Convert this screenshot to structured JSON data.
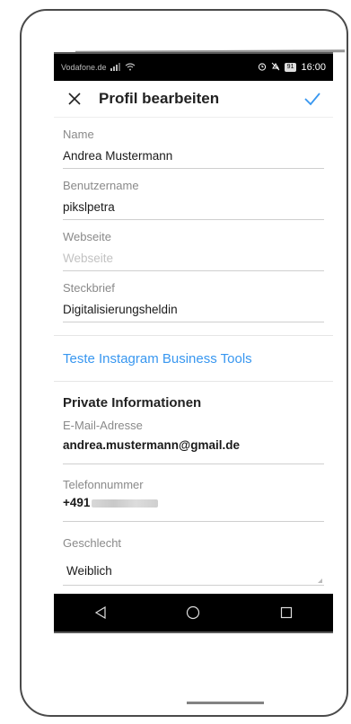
{
  "status_bar": {
    "carrier": "Vodafone.de",
    "battery": "91",
    "time": "16:00"
  },
  "app_bar": {
    "title": "Profil bearbeiten"
  },
  "fields": {
    "name": {
      "label": "Name",
      "value": "Andrea Mustermann"
    },
    "username": {
      "label": "Benutzername",
      "value": "pikslpetra"
    },
    "website": {
      "label": "Webseite",
      "placeholder": "Webseite"
    },
    "bio": {
      "label": "Steckbrief",
      "value": "Digitalisierungsheldin"
    }
  },
  "business_link": "Teste Instagram Business Tools",
  "private": {
    "title": "Private Informationen",
    "email": {
      "label": "E-Mail-Adresse",
      "value": "andrea.mustermann@gmail.de"
    },
    "phone": {
      "label": "Telefonnummer",
      "value": "+491"
    },
    "gender": {
      "label": "Geschlecht",
      "value": "Weiblich"
    }
  },
  "colors": {
    "accent": "#3897f0",
    "status_bar": "#000000"
  },
  "icons": {
    "close": "close-icon",
    "confirm": "checkmark-icon",
    "nav_back": "back-triangle-icon",
    "nav_home": "home-circle-icon",
    "nav_recents": "recents-square-icon"
  }
}
